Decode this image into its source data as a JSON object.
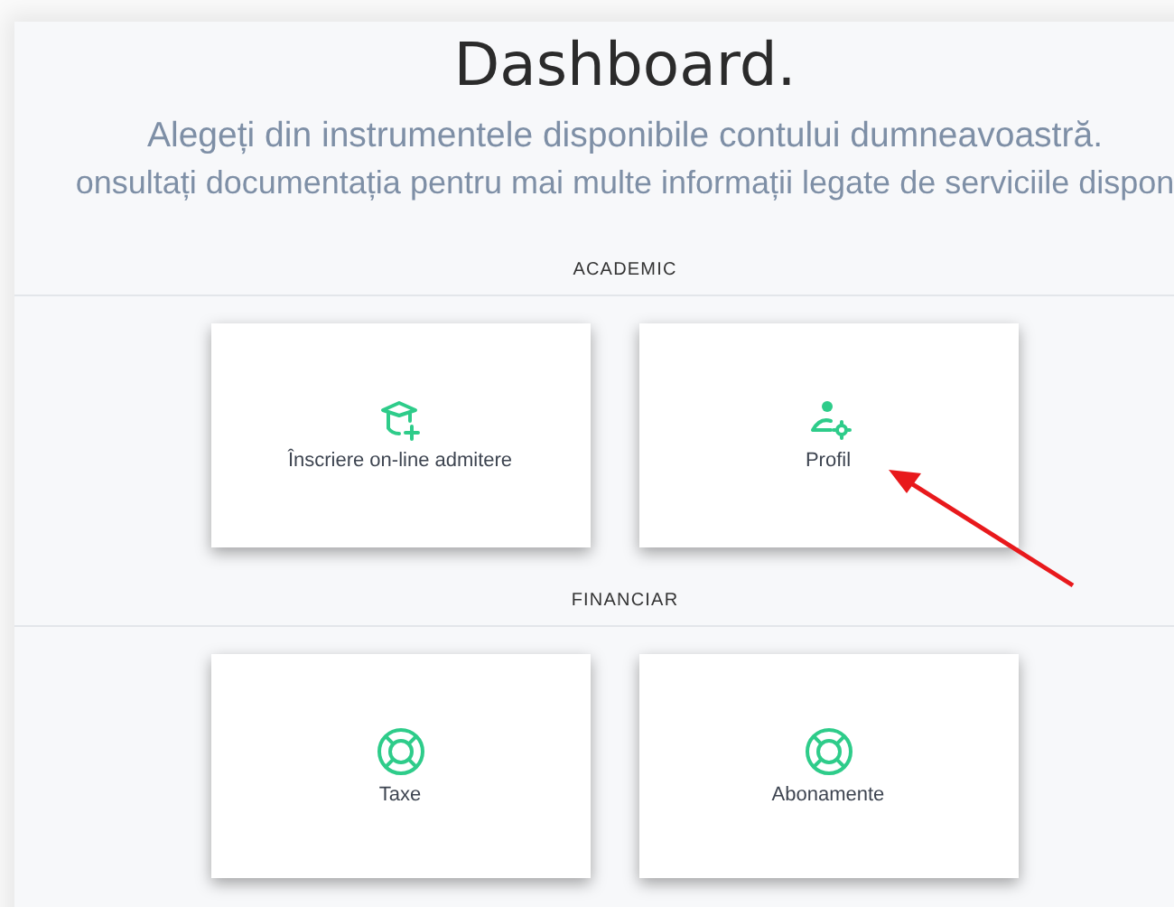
{
  "title": "Dashboard.",
  "subtitle_lines": [
    "Alegeți din instrumentele disponibile contului dumneavoastră.",
    "onsultați documentația pentru mai multe informații legate de serviciile dispon"
  ],
  "sections": [
    {
      "heading": "ACADEMIC",
      "cards": [
        {
          "label": "Înscriere on-line admitere",
          "kind": "graduation-add"
        },
        {
          "label": "Profil",
          "kind": "user-gear"
        }
      ]
    },
    {
      "heading": "FINANCIAR",
      "cards": [
        {
          "label": "Taxe",
          "kind": "lifebuoy"
        },
        {
          "label": "Abonamente",
          "kind": "lifebuoy"
        }
      ]
    }
  ]
}
